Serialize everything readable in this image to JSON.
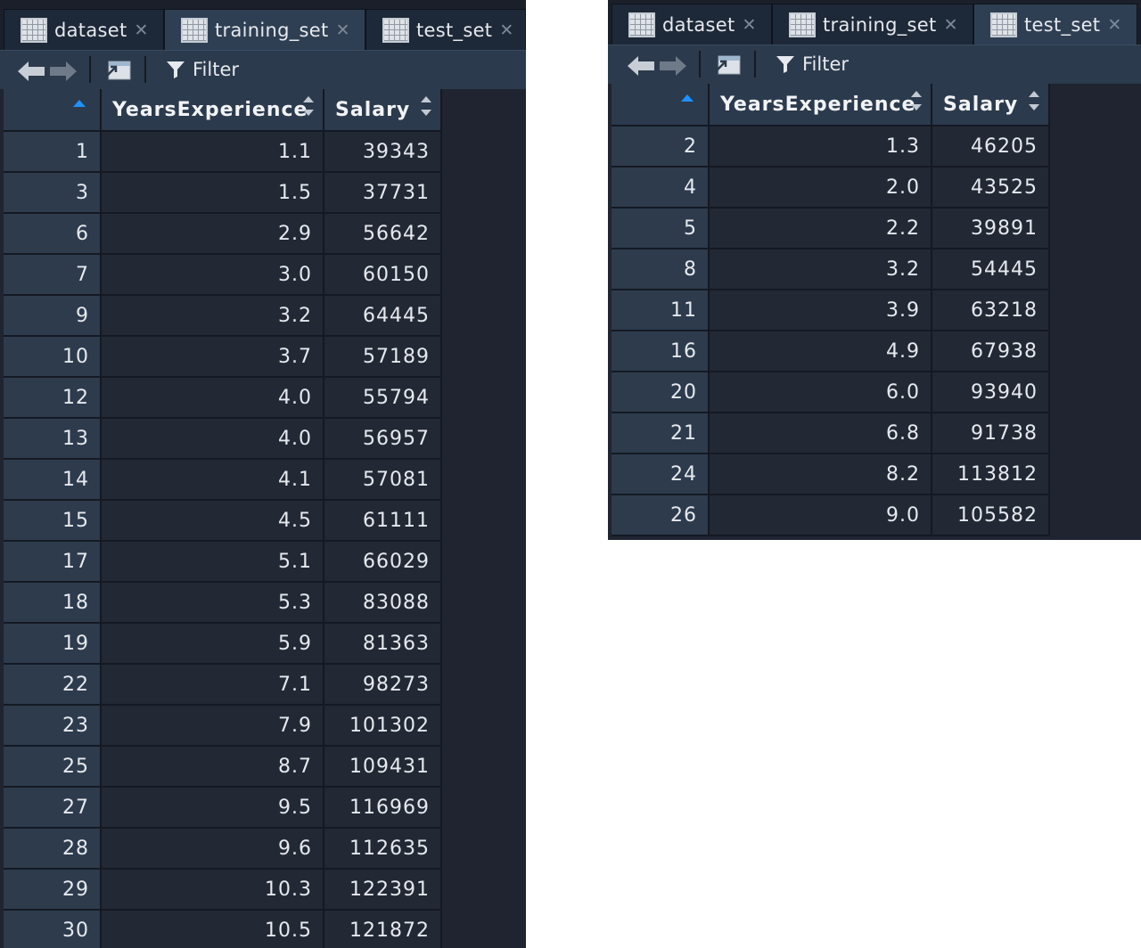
{
  "left_pane": {
    "tabs": [
      {
        "label": "dataset",
        "active": false
      },
      {
        "label": "training_set",
        "active": true
      },
      {
        "label": "test_set",
        "active": false
      }
    ],
    "toolbar": {
      "filter_label": "Filter"
    },
    "columns": [
      "",
      "YearsExperience",
      "Salary"
    ],
    "rows": [
      {
        "row": "1",
        "years": "1.1",
        "salary": "39343"
      },
      {
        "row": "3",
        "years": "1.5",
        "salary": "37731"
      },
      {
        "row": "6",
        "years": "2.9",
        "salary": "56642"
      },
      {
        "row": "7",
        "years": "3.0",
        "salary": "60150"
      },
      {
        "row": "9",
        "years": "3.2",
        "salary": "64445"
      },
      {
        "row": "10",
        "years": "3.7",
        "salary": "57189"
      },
      {
        "row": "12",
        "years": "4.0",
        "salary": "55794"
      },
      {
        "row": "13",
        "years": "4.0",
        "salary": "56957"
      },
      {
        "row": "14",
        "years": "4.1",
        "salary": "57081"
      },
      {
        "row": "15",
        "years": "4.5",
        "salary": "61111"
      },
      {
        "row": "17",
        "years": "5.1",
        "salary": "66029"
      },
      {
        "row": "18",
        "years": "5.3",
        "salary": "83088"
      },
      {
        "row": "19",
        "years": "5.9",
        "salary": "81363"
      },
      {
        "row": "22",
        "years": "7.1",
        "salary": "98273"
      },
      {
        "row": "23",
        "years": "7.9",
        "salary": "101302"
      },
      {
        "row": "25",
        "years": "8.7",
        "salary": "109431"
      },
      {
        "row": "27",
        "years": "9.5",
        "salary": "116969"
      },
      {
        "row": "28",
        "years": "9.6",
        "salary": "112635"
      },
      {
        "row": "29",
        "years": "10.3",
        "salary": "122391"
      },
      {
        "row": "30",
        "years": "10.5",
        "salary": "121872"
      }
    ]
  },
  "right_pane": {
    "tabs": [
      {
        "label": "dataset",
        "active": false
      },
      {
        "label": "training_set",
        "active": false
      },
      {
        "label": "test_set",
        "active": true
      }
    ],
    "toolbar": {
      "filter_label": "Filter"
    },
    "columns": [
      "",
      "YearsExperience",
      "Salary"
    ],
    "rows": [
      {
        "row": "2",
        "years": "1.3",
        "salary": "46205"
      },
      {
        "row": "4",
        "years": "2.0",
        "salary": "43525"
      },
      {
        "row": "5",
        "years": "2.2",
        "salary": "39891"
      },
      {
        "row": "8",
        "years": "3.2",
        "salary": "54445"
      },
      {
        "row": "11",
        "years": "3.9",
        "salary": "63218"
      },
      {
        "row": "16",
        "years": "4.9",
        "salary": "67938"
      },
      {
        "row": "20",
        "years": "6.0",
        "salary": "93940"
      },
      {
        "row": "21",
        "years": "6.8",
        "salary": "91738"
      },
      {
        "row": "24",
        "years": "8.2",
        "salary": "113812"
      },
      {
        "row": "26",
        "years": "9.0",
        "salary": "105582"
      }
    ]
  },
  "icons": {
    "tab": "table-grid-icon",
    "close": "close-icon",
    "back": "arrow-left-icon",
    "forward": "arrow-right-icon",
    "popout": "popout-window-icon",
    "filter": "funnel-icon",
    "sort_active": "sort-ascending-icon",
    "sort": "sort-icon"
  },
  "colors": {
    "accent_sort": "#1e90ff",
    "header_bg": "#2b3a4c",
    "cell_bg": "#222834",
    "pane_bg": "#1f2430"
  }
}
